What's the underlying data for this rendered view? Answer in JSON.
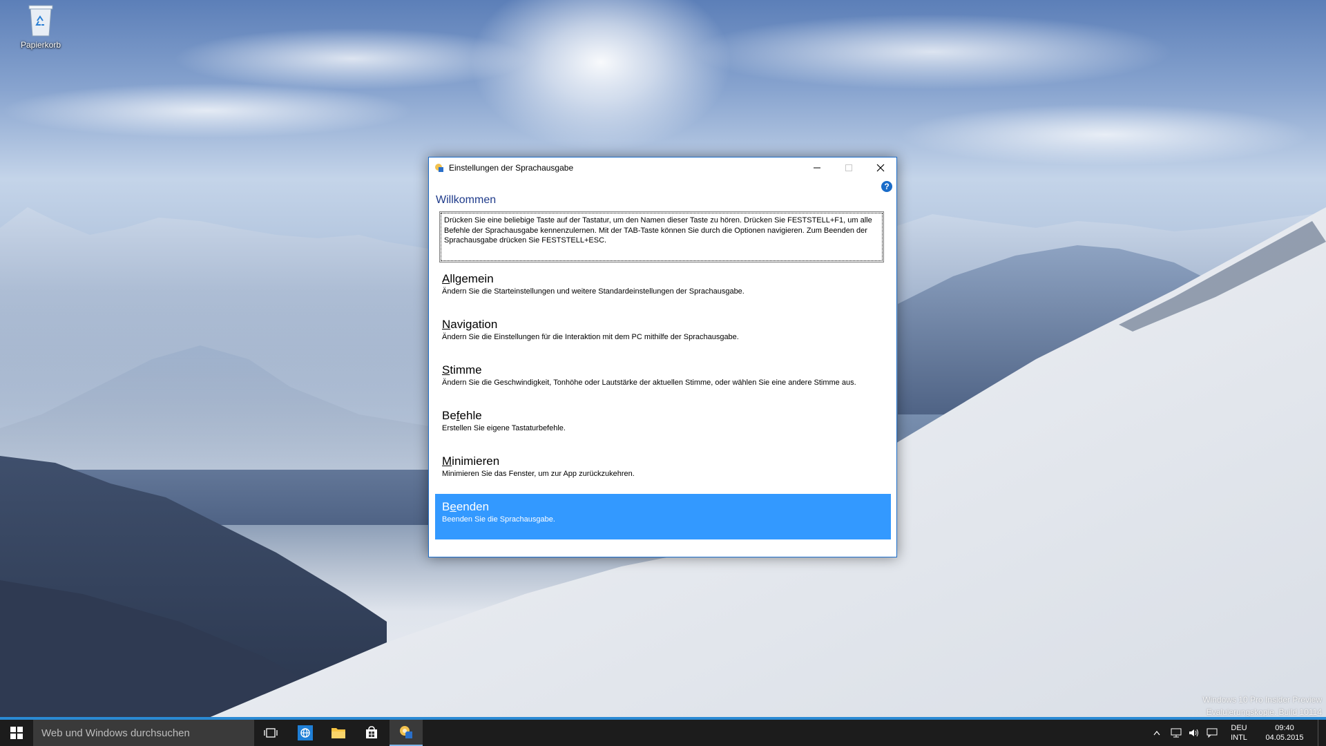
{
  "desktop": {
    "recycle_bin_label": "Papierkorb"
  },
  "dialog": {
    "title": "Einstellungen der Sprachausgabe",
    "heading": "Willkommen",
    "help_glyph": "?",
    "description": "Drücken Sie eine beliebige Taste auf der Tastatur, um den Namen dieser Taste zu hören. Drücken Sie FESTSTELL+F1, um alle Befehle der Sprachausgabe kennenzulernen. Mit der TAB-Taste können Sie durch die Optionen navigieren. Zum Beenden der Sprachausgabe drücken Sie FESTSTELL+ESC.",
    "options": [
      {
        "access_key": "A",
        "title_rest": "llgemein",
        "title_pre": "",
        "description": "Ändern Sie die Starteinstellungen und weitere Standardeinstellungen der Sprachausgabe."
      },
      {
        "access_key": "N",
        "title_rest": "avigation",
        "title_pre": "",
        "description": "Ändern Sie die Einstellungen für die Interaktion mit dem PC mithilfe der Sprachausgabe."
      },
      {
        "access_key": "S",
        "title_rest": "timme",
        "title_pre": "",
        "description": "Ändern Sie die Geschwindigkeit, Tonhöhe oder Lautstärke der aktuellen Stimme, oder wählen Sie eine andere Stimme aus."
      },
      {
        "access_key": "f",
        "title_rest": "ehle",
        "title_pre": "Be",
        "description": "Erstellen Sie eigene Tastaturbefehle."
      },
      {
        "access_key": "M",
        "title_rest": "inimieren",
        "title_pre": "",
        "description": "Minimieren Sie das Fenster, um zur App zurückzukehren."
      },
      {
        "access_key": "e",
        "title_rest": "enden",
        "title_pre": "B",
        "description": "Beenden Sie die Sprachausgabe."
      }
    ],
    "selected_index": 5,
    "accent_color": "#3399ff"
  },
  "watermark": {
    "line1": "Windows 10 Pro Insider Preview",
    "line2": "Evaluierungskopie. Build 10114"
  },
  "taskbar": {
    "search_placeholder": "Web und Windows durchsuchen",
    "language_top": "DEU",
    "language_bottom": "INTL",
    "time": "09:40",
    "date": "04.05.2015"
  }
}
